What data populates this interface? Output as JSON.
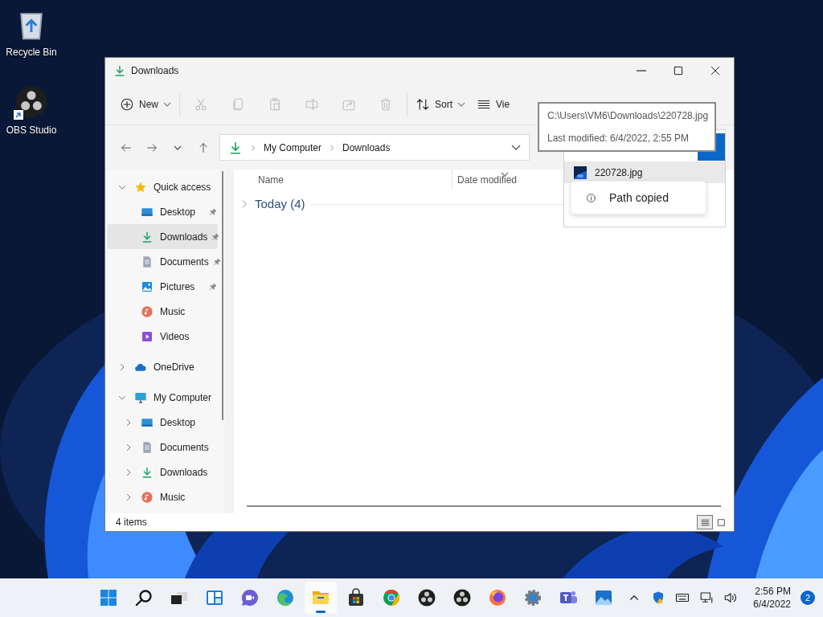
{
  "desktop_icons": [
    {
      "label": "Recycle Bin",
      "kind": "recycle",
      "shortcut": false
    },
    {
      "label": "OBS Studio",
      "kind": "obs",
      "shortcut": true
    }
  ],
  "window": {
    "title": "Downloads",
    "toolbar": [
      {
        "kind": "new",
        "label": "New",
        "dropdown": true,
        "disabled": false
      },
      {
        "kind": "separator"
      },
      {
        "kind": "cut",
        "disabled": true
      },
      {
        "kind": "copy",
        "disabled": true
      },
      {
        "kind": "paste",
        "disabled": true
      },
      {
        "kind": "rename",
        "disabled": true
      },
      {
        "kind": "share",
        "disabled": true
      },
      {
        "kind": "delete",
        "disabled": true
      },
      {
        "kind": "separator"
      },
      {
        "kind": "sort",
        "label": "Sort",
        "dropdown": true,
        "disabled": false
      },
      {
        "kind": "view",
        "label": "Vie",
        "disabled": false
      }
    ],
    "address": {
      "segments": [
        "My Computer",
        "Downloads"
      ]
    },
    "nav": [
      {
        "label": "Quick access",
        "kind": "star",
        "expanded": true,
        "selected": false,
        "children": [
          {
            "label": "Desktop",
            "kind": "desktop",
            "pinned": true,
            "selected": false
          },
          {
            "label": "Downloads",
            "kind": "download",
            "pinned": true,
            "selected": true
          },
          {
            "label": "Documents",
            "kind": "documents",
            "pinned": true,
            "selected": false
          },
          {
            "label": "Pictures",
            "kind": "pictures",
            "pinned": true,
            "selected": false
          },
          {
            "label": "Music",
            "kind": "music",
            "pinned": false,
            "selected": false
          },
          {
            "label": "Videos",
            "kind": "videos",
            "pinned": false,
            "selected": false
          }
        ]
      },
      {
        "label": "OneDrive",
        "kind": "cloud",
        "expanded": false,
        "selected": false
      },
      {
        "label": "My Computer",
        "kind": "monitor",
        "expanded": true,
        "selected": false,
        "children": [
          {
            "label": "Desktop",
            "kind": "desktop",
            "expanded": false,
            "selected": false
          },
          {
            "label": "Documents",
            "kind": "documents",
            "expanded": false,
            "selected": false
          },
          {
            "label": "Downloads",
            "kind": "download",
            "expanded": false,
            "selected": false
          },
          {
            "label": "Music",
            "kind": "music",
            "expanded": false,
            "selected": false
          }
        ]
      }
    ],
    "columns": [
      {
        "label": "Name",
        "sorted": false
      },
      {
        "label": "Date modified",
        "sorted": true
      }
    ],
    "groups": [
      {
        "label": "Today (4)",
        "expanded": false
      }
    ],
    "status_bar": {
      "text": "4 items",
      "views": [
        {
          "kind": "details",
          "selected": true
        },
        {
          "kind": "tiles",
          "selected": false
        }
      ]
    }
  },
  "tooltip": {
    "path": "C:\\Users\\VM6\\Downloads\\220728.jpg",
    "modified": "Last modified: 6/4/2022, 2:55 PM"
  },
  "drop_panel": {
    "file": "220728.jpg",
    "toast": "Path copied"
  },
  "taskbar": {
    "apps": [
      {
        "kind": "start",
        "active": false
      },
      {
        "kind": "search",
        "active": false
      },
      {
        "kind": "taskview",
        "active": false
      },
      {
        "kind": "widgets",
        "active": false
      },
      {
        "kind": "chat",
        "active": false
      },
      {
        "kind": "edge",
        "active": false
      },
      {
        "kind": "explorer",
        "active": true
      },
      {
        "kind": "store",
        "active": false
      },
      {
        "kind": "chrome",
        "active": false
      },
      {
        "kind": "obs",
        "active": false
      },
      {
        "kind": "obs",
        "active": false
      },
      {
        "kind": "firefox",
        "active": false
      },
      {
        "kind": "settings",
        "active": false
      },
      {
        "kind": "teams",
        "active": false
      },
      {
        "kind": "photos",
        "active": false
      }
    ],
    "tray": [
      {
        "kind": "caret"
      },
      {
        "kind": "shield"
      },
      {
        "kind": "keyboard"
      },
      {
        "kind": "network"
      },
      {
        "kind": "volume"
      }
    ],
    "time": "2:56 PM",
    "date": "6/4/2022",
    "notifications": "2"
  }
}
